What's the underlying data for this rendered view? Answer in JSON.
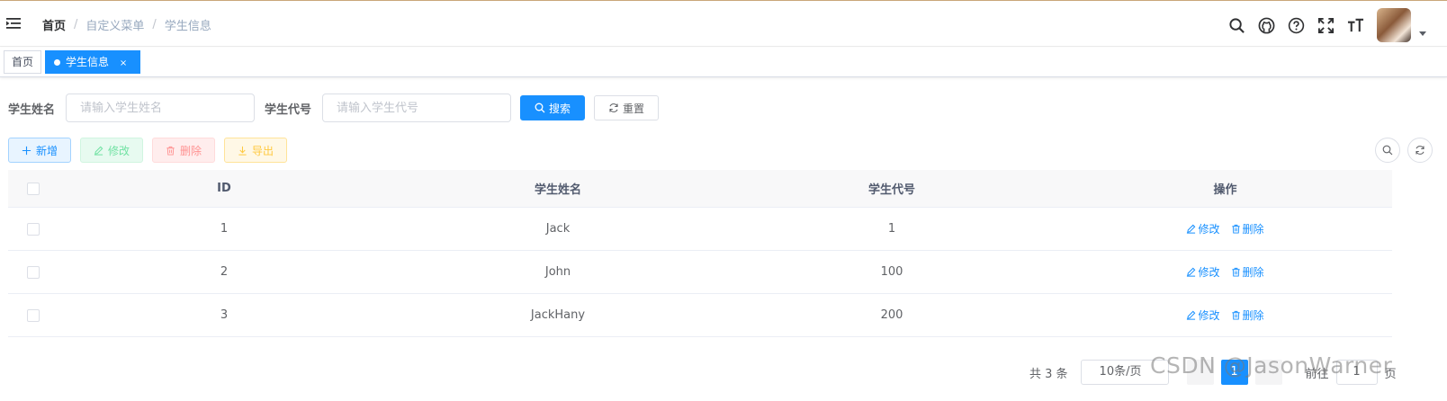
{
  "navbar": {
    "breadcrumb": [
      "首页",
      "自定义菜单",
      "学生信息"
    ],
    "separator": "/",
    "icons": [
      "search-icon",
      "github-icon",
      "question-icon",
      "fullscreen-icon",
      "font-size-icon"
    ]
  },
  "tags": {
    "home": "首页",
    "active": "学生信息",
    "close": "×"
  },
  "search": {
    "name_label": "学生姓名",
    "name_placeholder": "请输入学生姓名",
    "name_value": "",
    "code_label": "学生代号",
    "code_placeholder": "请输入学生代号",
    "code_value": "",
    "search_button": "搜索",
    "reset_button": "重置"
  },
  "toolbar": {
    "add": "新增",
    "edit": "修改",
    "delete": "删除",
    "export": "导出"
  },
  "table": {
    "columns": [
      "ID",
      "学生姓名",
      "学生代号",
      "操作"
    ],
    "rows": [
      {
        "id": "1",
        "name": "Jack",
        "code": "1"
      },
      {
        "id": "2",
        "name": "John",
        "code": "100"
      },
      {
        "id": "3",
        "name": "JackHany",
        "code": "200"
      }
    ],
    "op_edit": "修改",
    "op_delete": "删除"
  },
  "pagination": {
    "total": "共 3 条",
    "page_size": "10条/页",
    "current_page": "1",
    "goto": "前往",
    "jump_value": "1",
    "page_suffix": "页"
  },
  "watermark": "CSDN @JasonWarner",
  "colors": {
    "primary": "#1890ff",
    "success_light": "#71e2a3",
    "danger_light": "#ff9292",
    "warning_light": "#ffc940"
  }
}
